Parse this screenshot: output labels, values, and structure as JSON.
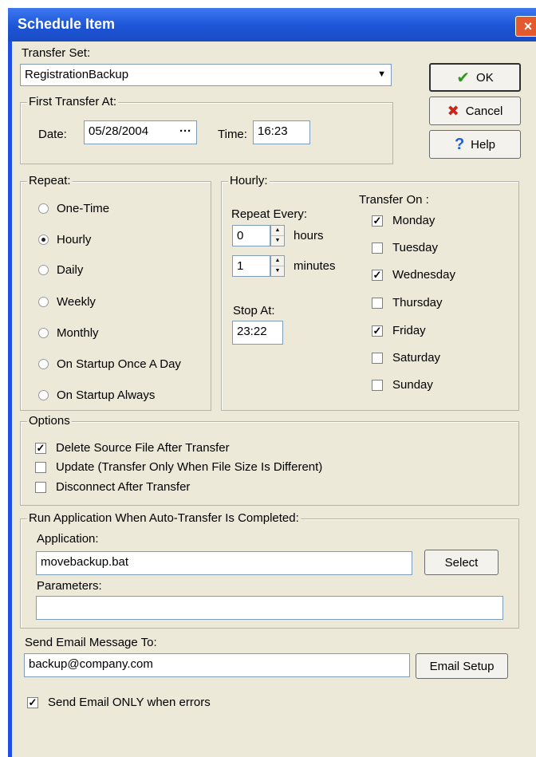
{
  "window": {
    "title": "Schedule Item",
    "close_label": "×"
  },
  "transfer_set": {
    "label": "Transfer Set:",
    "value": "RegistrationBackup",
    "dropdown_icon": "▼"
  },
  "first_transfer": {
    "legend": "First Transfer At:",
    "date_label": "Date:",
    "date_value": "05/28/2004",
    "date_button": "···",
    "time_label": "Time:",
    "time_value": "16:23"
  },
  "buttons": {
    "ok": {
      "icon": "✔",
      "label": "OK"
    },
    "cancel": {
      "icon": "✖",
      "label": "Cancel"
    },
    "help": {
      "icon": "?",
      "label": "Help"
    }
  },
  "repeat": {
    "legend": "Repeat:",
    "options": [
      {
        "label": "One-Time",
        "selected": false
      },
      {
        "label": "Hourly",
        "selected": true
      },
      {
        "label": "Daily",
        "selected": false
      },
      {
        "label": "Weekly",
        "selected": false
      },
      {
        "label": "Monthly",
        "selected": false
      },
      {
        "label": "On Startup Once A Day",
        "selected": false
      },
      {
        "label": "On Startup Always",
        "selected": false
      }
    ]
  },
  "hourly": {
    "legend": "Hourly:",
    "repeat_every_label": "Repeat Every:",
    "hours_value": "0",
    "hours_label": "hours",
    "minutes_value": "1",
    "minutes_label": "minutes",
    "stop_at_label": "Stop At:",
    "stop_at_value": "23:22",
    "transfer_on_label": "Transfer On :",
    "days": [
      {
        "label": "Monday",
        "checked": true
      },
      {
        "label": "Tuesday",
        "checked": false
      },
      {
        "label": "Wednesday",
        "checked": true
      },
      {
        "label": "Thursday",
        "checked": false
      },
      {
        "label": "Friday",
        "checked": true
      },
      {
        "label": "Saturday",
        "checked": false
      },
      {
        "label": "Sunday",
        "checked": false
      }
    ]
  },
  "options": {
    "legend": "Options",
    "items": [
      {
        "label": "Delete Source File After Transfer",
        "checked": true
      },
      {
        "label": "Update (Transfer Only When File Size Is Different)",
        "checked": false
      },
      {
        "label": "Disconnect After Transfer",
        "checked": false
      }
    ]
  },
  "run_app": {
    "legend": "Run Application When Auto-Transfer Is Completed:",
    "application_label": "Application:",
    "application_value": "movebackup.bat",
    "select_label": "Select",
    "parameters_label": "Parameters:",
    "parameters_value": ""
  },
  "email": {
    "label": "Send Email Message To:",
    "value": "backup@company.com",
    "setup_label": "Email Setup",
    "only_errors_label": "Send Email ONLY when errors",
    "only_errors_checked": true
  },
  "glyphs": {
    "check": "✓"
  },
  "colors": {
    "ok_icon": "#2e9a1e",
    "cancel_icon": "#c8251c",
    "help_icon": "#1e5fd6",
    "title_bar": "#1d55d6",
    "dialog_bg": "#ece9d8"
  }
}
